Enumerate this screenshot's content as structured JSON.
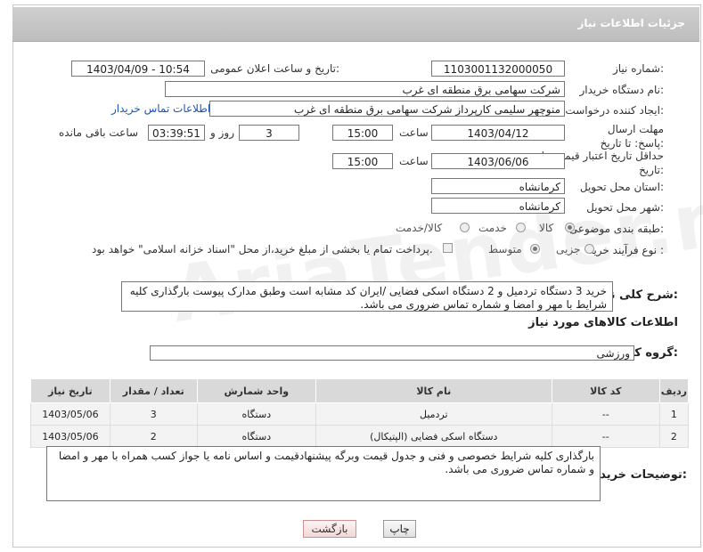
{
  "header": {
    "title": "جزئیات اطلاعات نیاز"
  },
  "fields": {
    "need_number_label": "شماره نیاز:",
    "need_number": "1103001132000050",
    "announce_label": "تاریخ و ساعت اعلان عمومی:",
    "announce_value": "1403/04/09 - 10:54",
    "buyer_org_label": "نام دستگاه خریدار:",
    "buyer_org": "شرکت سهامی برق منطقه ای غرب",
    "requester_label": "ایجاد کننده درخواست:",
    "requester": "منوچهر  سلیمی کارپرداز شرکت سهامی برق منطقه ای غرب",
    "contact_link": "اطلاعات تماس خریدار",
    "send_deadline_label": "مهلت ارسال پاسخ: تا تاریخ:",
    "send_date": "1403/04/12",
    "time_label": "ساعت",
    "send_time": "15:00",
    "days_value": "3",
    "days_label": "روز و",
    "remaining_time": "03:39:51",
    "remaining_label": "ساعت باقی مانده",
    "validity_label": "حداقل تاریخ اعتبار قیمت: تا تاریخ:",
    "validity_date": "1403/06/06",
    "validity_time": "15:00",
    "province_label": "استان محل تحویل:",
    "province": "کرمانشاه",
    "city_label": "شهر محل تحویل:",
    "city": "کرمانشاه",
    "category_label": "طبقه بندی موضوعی:",
    "category_options": [
      "کالا",
      "خدمت",
      "کالا/خدمت"
    ],
    "process_label": "نوع فرآیند خرید :",
    "process_options": [
      "جزیی",
      "متوسط"
    ],
    "payment_note": "پرداخت تمام یا بخشی از مبلغ خرید،از محل \"اسناد خزانه اسلامی\" خواهد بود."
  },
  "description": {
    "label": "شرح کلی نیاز:",
    "text": "خرید 3 دستگاه تردمیل و 2 دستگاه اسکی فضایی /ایران کد مشابه است وطبق مدارک پیوست بارگذاری کلیه شرایط  با مهر و امضا و شماره تماس ضروری می باشد."
  },
  "goods_section": {
    "title": "اطلاعات کالاهای مورد نیاز",
    "group_label": "گروه کالا:",
    "group_value": "ورزشی"
  },
  "table": {
    "headers": [
      "ردیف",
      "کد کالا",
      "نام کالا",
      "واحد شمارش",
      "تعداد / مقدار",
      "تاریخ نیاز"
    ],
    "rows": [
      [
        "1",
        "--",
        "تردمیل",
        "دستگاه",
        "3",
        "1403/05/06"
      ],
      [
        "2",
        "--",
        "دستگاه اسکی فضایی (الپتیکال)",
        "دستگاه",
        "2",
        "1403/05/06"
      ]
    ]
  },
  "buyer_notes": {
    "label": "توضیحات خریدار:",
    "text": "بارگذاری کلیه شرایط خصوصی و فنی و جدول قیمت وبرگه پیشنهادقیمت و اساس نامه یا جواز کسب همراه با مهر و امضا و شماره تماس ضروری می باشد."
  },
  "buttons": {
    "print": "چاپ",
    "back": "بازگشت"
  },
  "watermark": "AriaTender.neT"
}
